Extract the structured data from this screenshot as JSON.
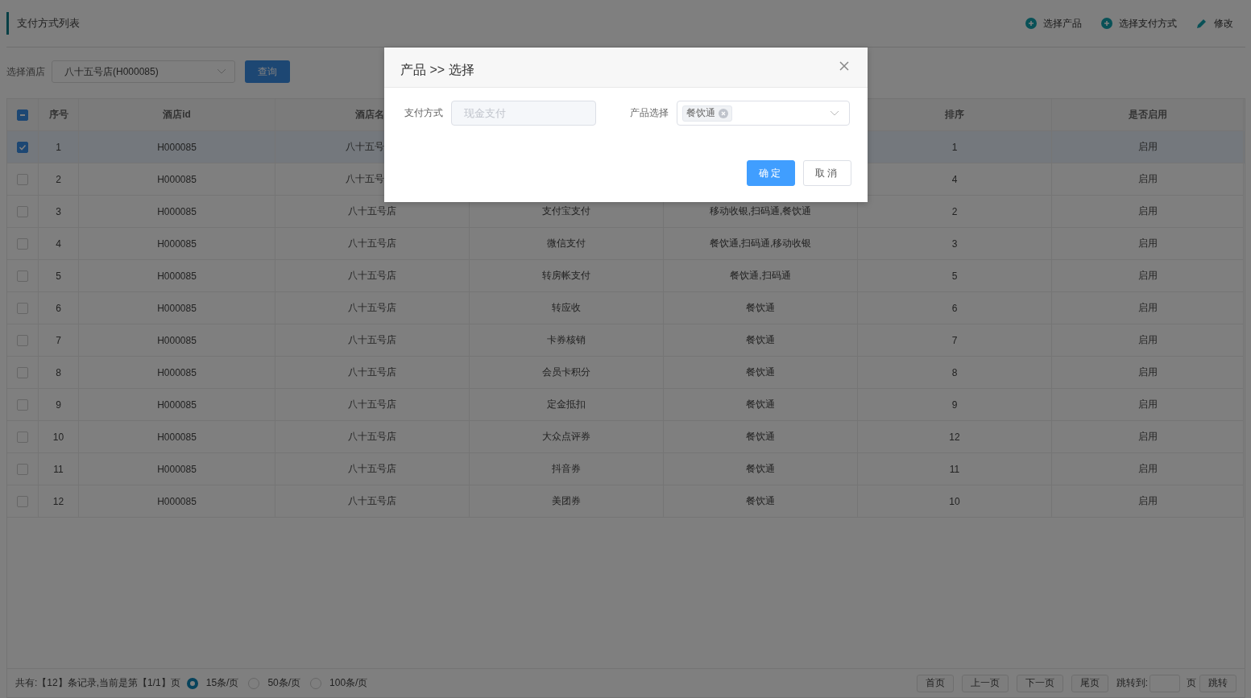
{
  "page": {
    "title": "支付方式列表",
    "actions": [
      {
        "kind": "add",
        "label": "选择产品"
      },
      {
        "kind": "add",
        "label": "选择支付方式"
      },
      {
        "kind": "edit",
        "label": "修改"
      }
    ]
  },
  "filter": {
    "label": "选择酒店",
    "value": "八十五号店(H000085)",
    "button": "查询"
  },
  "table": {
    "header_checkbox": {
      "indeterminate": true
    },
    "columns": [
      "序号",
      "酒店id",
      "酒店名",
      null,
      null,
      "排序",
      "是否启用"
    ],
    "rows": [
      {
        "selected": true,
        "cells": [
          "1",
          "H000085",
          "八十五号",
          null,
          null,
          "1",
          "启用"
        ]
      },
      {
        "selected": false,
        "cells": [
          "2",
          "H000085",
          "八十五号",
          null,
          null,
          "4",
          "启用"
        ]
      },
      {
        "selected": false,
        "cells": [
          "3",
          "H000085",
          "八十五号店",
          "支付宝支付",
          "移动收银,扫码通,餐饮通",
          "2",
          "启用"
        ]
      },
      {
        "selected": false,
        "cells": [
          "4",
          "H000085",
          "八十五号店",
          "微信支付",
          "餐饮通,扫码通,移动收银",
          "3",
          "启用"
        ]
      },
      {
        "selected": false,
        "cells": [
          "5",
          "H000085",
          "八十五号店",
          "转房帐支付",
          "餐饮通,扫码通",
          "5",
          "启用"
        ]
      },
      {
        "selected": false,
        "cells": [
          "6",
          "H000085",
          "八十五号店",
          "转应收",
          "餐饮通",
          "6",
          "启用"
        ]
      },
      {
        "selected": false,
        "cells": [
          "7",
          "H000085",
          "八十五号店",
          "卡券核销",
          "餐饮通",
          "7",
          "启用"
        ]
      },
      {
        "selected": false,
        "cells": [
          "8",
          "H000085",
          "八十五号店",
          "会员卡积分",
          "餐饮通",
          "8",
          "启用"
        ]
      },
      {
        "selected": false,
        "cells": [
          "9",
          "H000085",
          "八十五号店",
          "定金抵扣",
          "餐饮通",
          "9",
          "启用"
        ]
      },
      {
        "selected": false,
        "cells": [
          "10",
          "H000085",
          "八十五号店",
          "大众点评券",
          "餐饮通",
          "12",
          "启用"
        ]
      },
      {
        "selected": false,
        "cells": [
          "11",
          "H000085",
          "八十五号店",
          "抖音券",
          "餐饮通",
          "11",
          "启用"
        ]
      },
      {
        "selected": false,
        "cells": [
          "12",
          "H000085",
          "八十五号店",
          "美团券",
          "餐饮通",
          "10",
          "启用"
        ]
      }
    ]
  },
  "footer": {
    "summary": "共有:【12】条记录,当前是第【1/1】页",
    "page_sizes": [
      {
        "label": "15条/页",
        "selected": true
      },
      {
        "label": "50条/页",
        "selected": false
      },
      {
        "label": "100条/页",
        "selected": false
      }
    ],
    "nav_buttons": [
      "首页",
      "上一页",
      "下一页",
      "尾页"
    ],
    "jump_label": "跳转到:",
    "jump_unit": "页",
    "jump_button": "跳转"
  },
  "dialog": {
    "title": "产品 >> 选择",
    "payment_label": "支付方式",
    "payment_value": "现金支付",
    "payment_disabled": true,
    "product_label": "产品选择",
    "product_tags": [
      "餐饮通"
    ],
    "buttons": [
      {
        "kind": "primary",
        "label": "确定"
      },
      {
        "kind": "default",
        "label": "取消"
      }
    ]
  }
}
